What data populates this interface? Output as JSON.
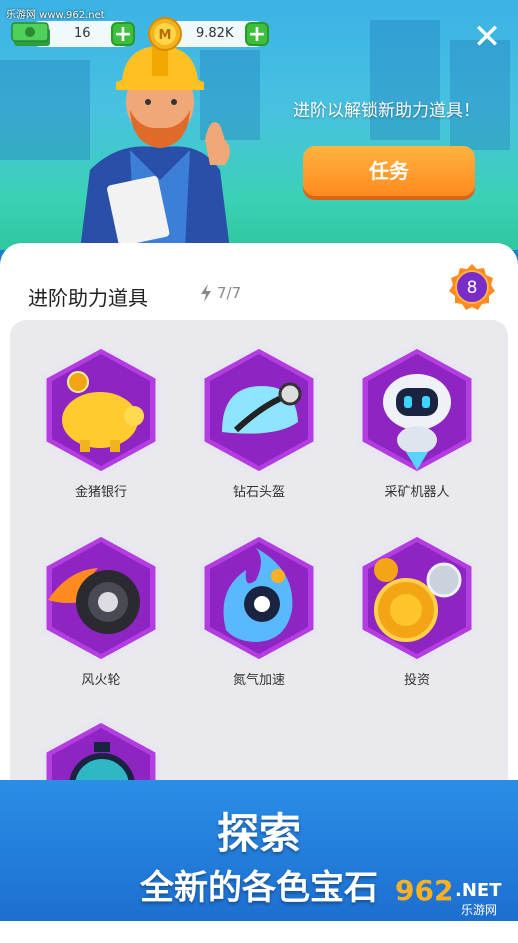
{
  "watermark": "乐游网 www.962.net",
  "topbar": {
    "cash_value": "16",
    "coin_value": "9.82K",
    "coin_glyph": "M",
    "plus": "+",
    "close": "✕"
  },
  "hero": {
    "message": "进阶以解锁新助力道具！",
    "task_button": "任务"
  },
  "panel": {
    "title": "进阶助力道具",
    "counter_icon": "lightning-icon",
    "counter": "7/7",
    "level": "8"
  },
  "items": [
    {
      "label": "金猪银行",
      "icon": "piggy-bank-icon"
    },
    {
      "label": "钻石头盔",
      "icon": "diamond-helmet-icon"
    },
    {
      "label": "采矿机器人",
      "icon": "mining-robot-icon"
    },
    {
      "label": "风火轮",
      "icon": "fire-wheel-icon"
    },
    {
      "label": "氮气加速",
      "icon": "nitro-boost-icon"
    },
    {
      "label": "投资",
      "icon": "investment-gears-icon"
    },
    {
      "label": "",
      "icon": "stopwatch-icon"
    }
  ],
  "banner": {
    "line1": "探索",
    "line2": "全新的各色宝石",
    "logo_main": "962",
    "logo_net": ".NET",
    "logo_sub": "乐游网"
  },
  "colors": {
    "accent_orange": "#ff9a2a",
    "hex_purple": "#a02ad6",
    "panel_bg": "#e9e9ee",
    "plus_green": "#3cbf3a"
  }
}
